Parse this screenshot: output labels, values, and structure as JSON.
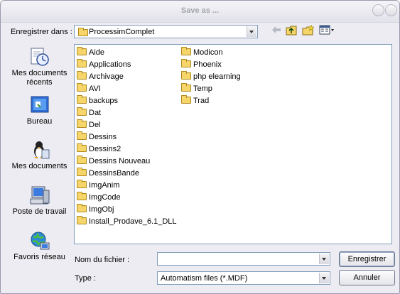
{
  "window": {
    "title": "Save as ..."
  },
  "savein": {
    "label": "Enregistrer dans :",
    "value": "ProcessimComplet"
  },
  "toolbar": {
    "back_icon": "back-arrow-icon",
    "up_icon": "up-folder-icon",
    "new_folder_icon": "new-folder-icon",
    "views_icon": "views-menu-icon"
  },
  "places": [
    {
      "label": "Mes documents récents",
      "icon": "recent-documents-icon"
    },
    {
      "label": "Bureau",
      "icon": "desktop-icon"
    },
    {
      "label": "Mes documents",
      "icon": "my-documents-icon"
    },
    {
      "label": "Poste de travail",
      "icon": "my-computer-icon"
    },
    {
      "label": "Favoris réseau",
      "icon": "network-places-icon"
    }
  ],
  "files": {
    "col1": [
      "Aide",
      "Applications",
      "Archivage",
      "AVI",
      "backups",
      "Dat",
      "Del",
      "Dessins",
      "Dessins2",
      "Dessins Nouveau",
      "DessinsBande",
      "ImgAnim",
      "ImgCode",
      "ImgObj",
      "Install_Prodave_6.1_DLL"
    ],
    "col2": [
      "Modicon",
      "Phoenix",
      "php elearning",
      "Temp",
      "Trad"
    ]
  },
  "filename": {
    "label": "Nom du fichier :",
    "value": ""
  },
  "filetype": {
    "label": "Type :",
    "value": "Automatism files (*.MDF)"
  },
  "buttons": {
    "save": "Enregistrer",
    "cancel": "Annuler"
  },
  "colors": {
    "field_border": "#7f9db9",
    "folder": "#f6d66a",
    "dialog_bg": "#ececf2"
  }
}
